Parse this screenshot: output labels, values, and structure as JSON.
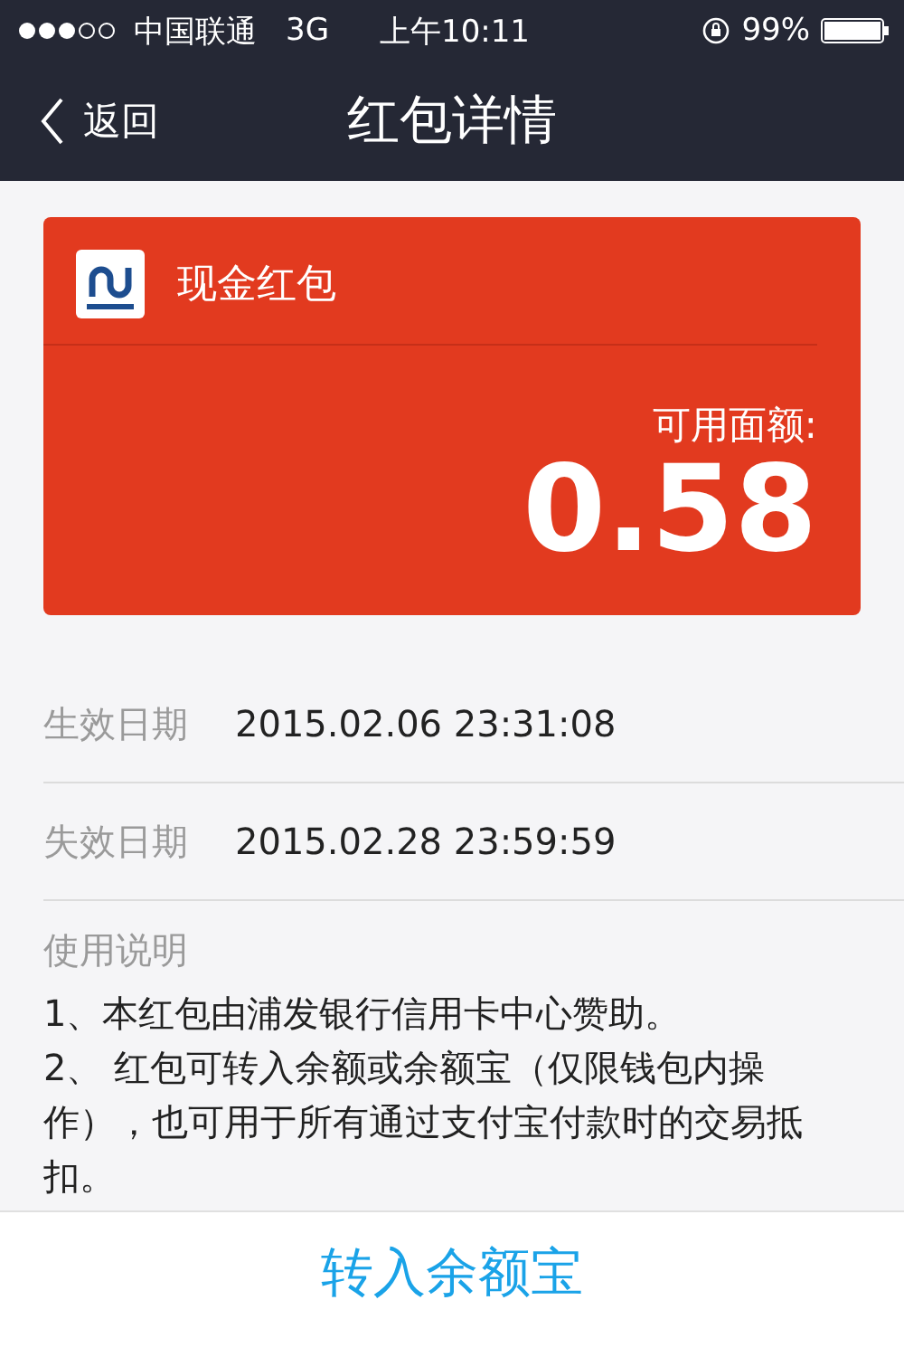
{
  "status_bar": {
    "carrier": "中国联通",
    "network": "3G",
    "time": "上午10:11",
    "battery": "99%"
  },
  "nav": {
    "back": "返回",
    "title": "红包详情"
  },
  "card": {
    "name": "现金红包",
    "amount_label": "可用面额:",
    "amount": "0.58"
  },
  "details": [
    {
      "label": "生效日期",
      "value": "2015.02.06 23:31:08"
    },
    {
      "label": "失效日期",
      "value": "2015.02.28 23:59:59"
    }
  ],
  "instructions": {
    "heading": "使用说明",
    "items": [
      "1、本红包由浦发银行信用卡中心赞助。",
      "2、 红包可转入余额或余额宝（仅限钱包内操作），也可用于所有通过支付宝付款时的交易抵扣。"
    ]
  },
  "action": "转入余额宝"
}
